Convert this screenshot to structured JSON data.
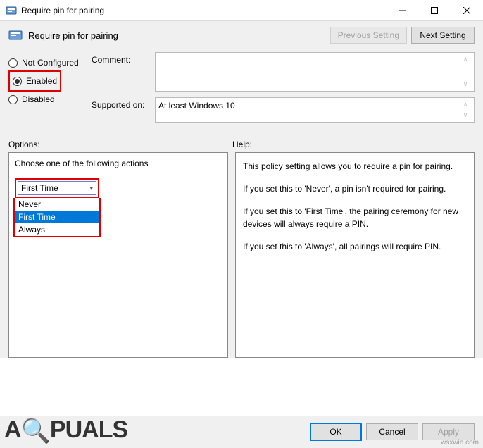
{
  "window": {
    "title": "Require pin for pairing"
  },
  "policy": {
    "title": "Require pin for pairing"
  },
  "nav": {
    "prev": "Previous Setting",
    "next": "Next Setting"
  },
  "state_options": {
    "not_configured": "Not Configured",
    "enabled": "Enabled",
    "disabled": "Disabled"
  },
  "fields": {
    "comment_label": "Comment:",
    "comment_value": "",
    "supported_label": "Supported on:",
    "supported_value": "At least Windows 10"
  },
  "sections": {
    "options": "Options:",
    "help": "Help:"
  },
  "options_panel": {
    "subtitle": "Choose one of the following actions",
    "selected": "First Time",
    "items": [
      "Never",
      "First Time",
      "Always"
    ]
  },
  "help_text": {
    "p1": "This policy setting allows you to require a pin for pairing.",
    "p2": "If you set this to 'Never', a pin isn't required for pairing.",
    "p3": "If you set this to 'First Time', the pairing ceremony for new devices will always require a PIN.",
    "p4": "If you set this to 'Always', all pairings will require PIN."
  },
  "buttons": {
    "ok": "OK",
    "cancel": "Cancel",
    "apply": "Apply"
  },
  "watermark": "APPUALS",
  "source": "wsxwin.com"
}
